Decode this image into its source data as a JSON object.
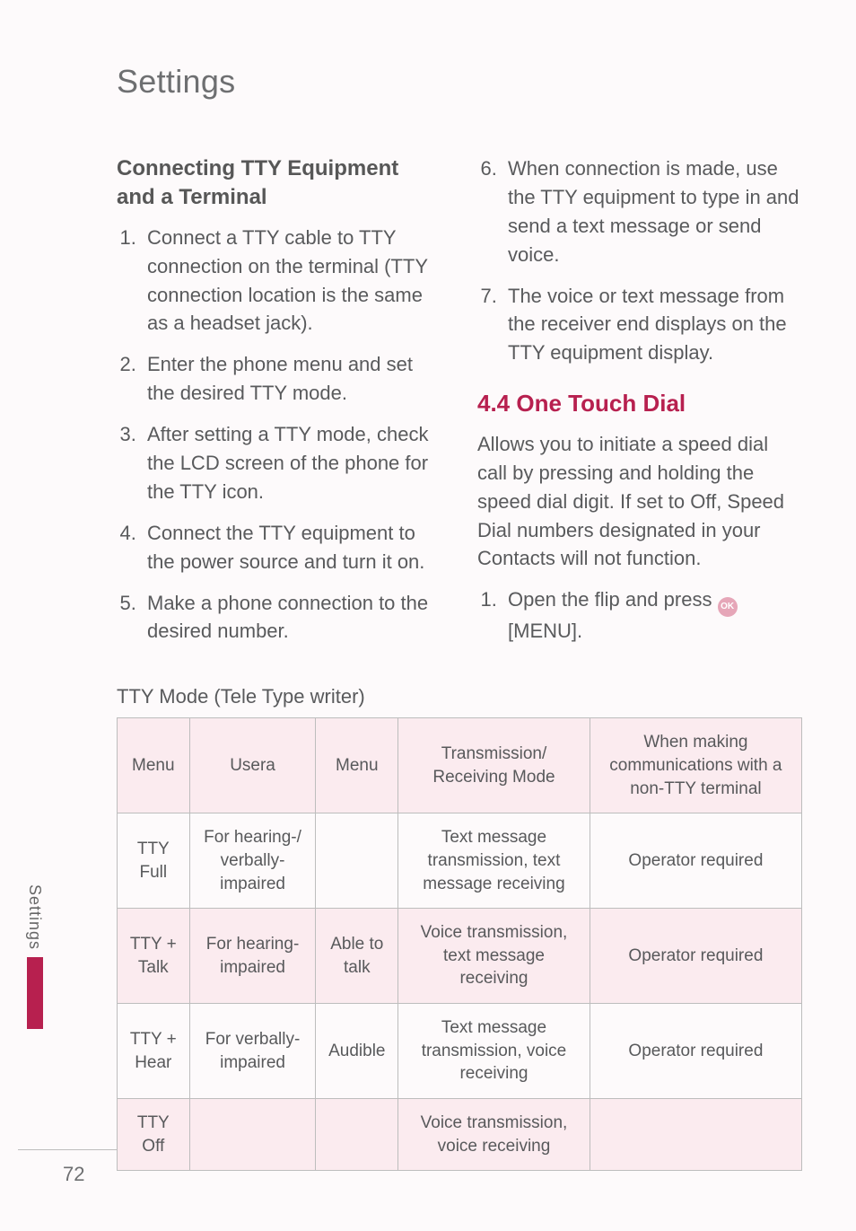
{
  "chapter_title": "Settings",
  "left": {
    "heading": "Connecting TTY Equipment and a Terminal",
    "items": [
      "Connect a TTY cable to TTY connection on the terminal (TTY connection location is the same as a headset jack).",
      "Enter the phone menu and set the desired TTY mode.",
      "After setting a TTY mode, check the LCD screen of the phone for the TTY icon.",
      "Connect the TTY equipment to the power source and turn it on.",
      "Make a phone connection to the desired number."
    ]
  },
  "right": {
    "items": [
      "When connection is made, use the TTY equipment to type in and send a text message or send voice.",
      "The voice or text message from the receiver end displays on the TTY equipment display."
    ],
    "section_heading": "4.4 One Touch Dial",
    "section_body": "Allows you to initiate a speed dial call by pressing and holding the speed dial digit. If set to Off, Speed Dial numbers designated in your Contacts will not function.",
    "step_prefix": "Open the flip and press ",
    "ok_icon_label": "OK",
    "step_suffix": " [MENU]."
  },
  "tty_caption": "TTY Mode (Tele Type writer)",
  "table": {
    "headers": [
      "Menu",
      "Usera",
      "Menu",
      "Transmission/ Receiving Mode",
      "When making communications with a non-TTY terminal"
    ],
    "rows": [
      {
        "c0": "TTY Full",
        "c1": "For hearing-/ verbally- impaired",
        "c2": "",
        "c3": "Text message transmission, text message receiving",
        "c4": "Operator required"
      },
      {
        "c0": "TTY + Talk",
        "c1": "For hearing- impaired",
        "c2": "Able to talk",
        "c3": "Voice transmission, text message receiving",
        "c4": "Operator required"
      },
      {
        "c0": "TTY + Hear",
        "c1": "For verbally- impaired",
        "c2": "Audible",
        "c3": "Text message transmission, voice receiving",
        "c4": "Operator required"
      },
      {
        "c0": "TTY Off",
        "c1": "",
        "c2": "",
        "c3": "Voice transmission, voice receiving",
        "c4": ""
      }
    ]
  },
  "side_tab": "Settings",
  "page_number": "72"
}
